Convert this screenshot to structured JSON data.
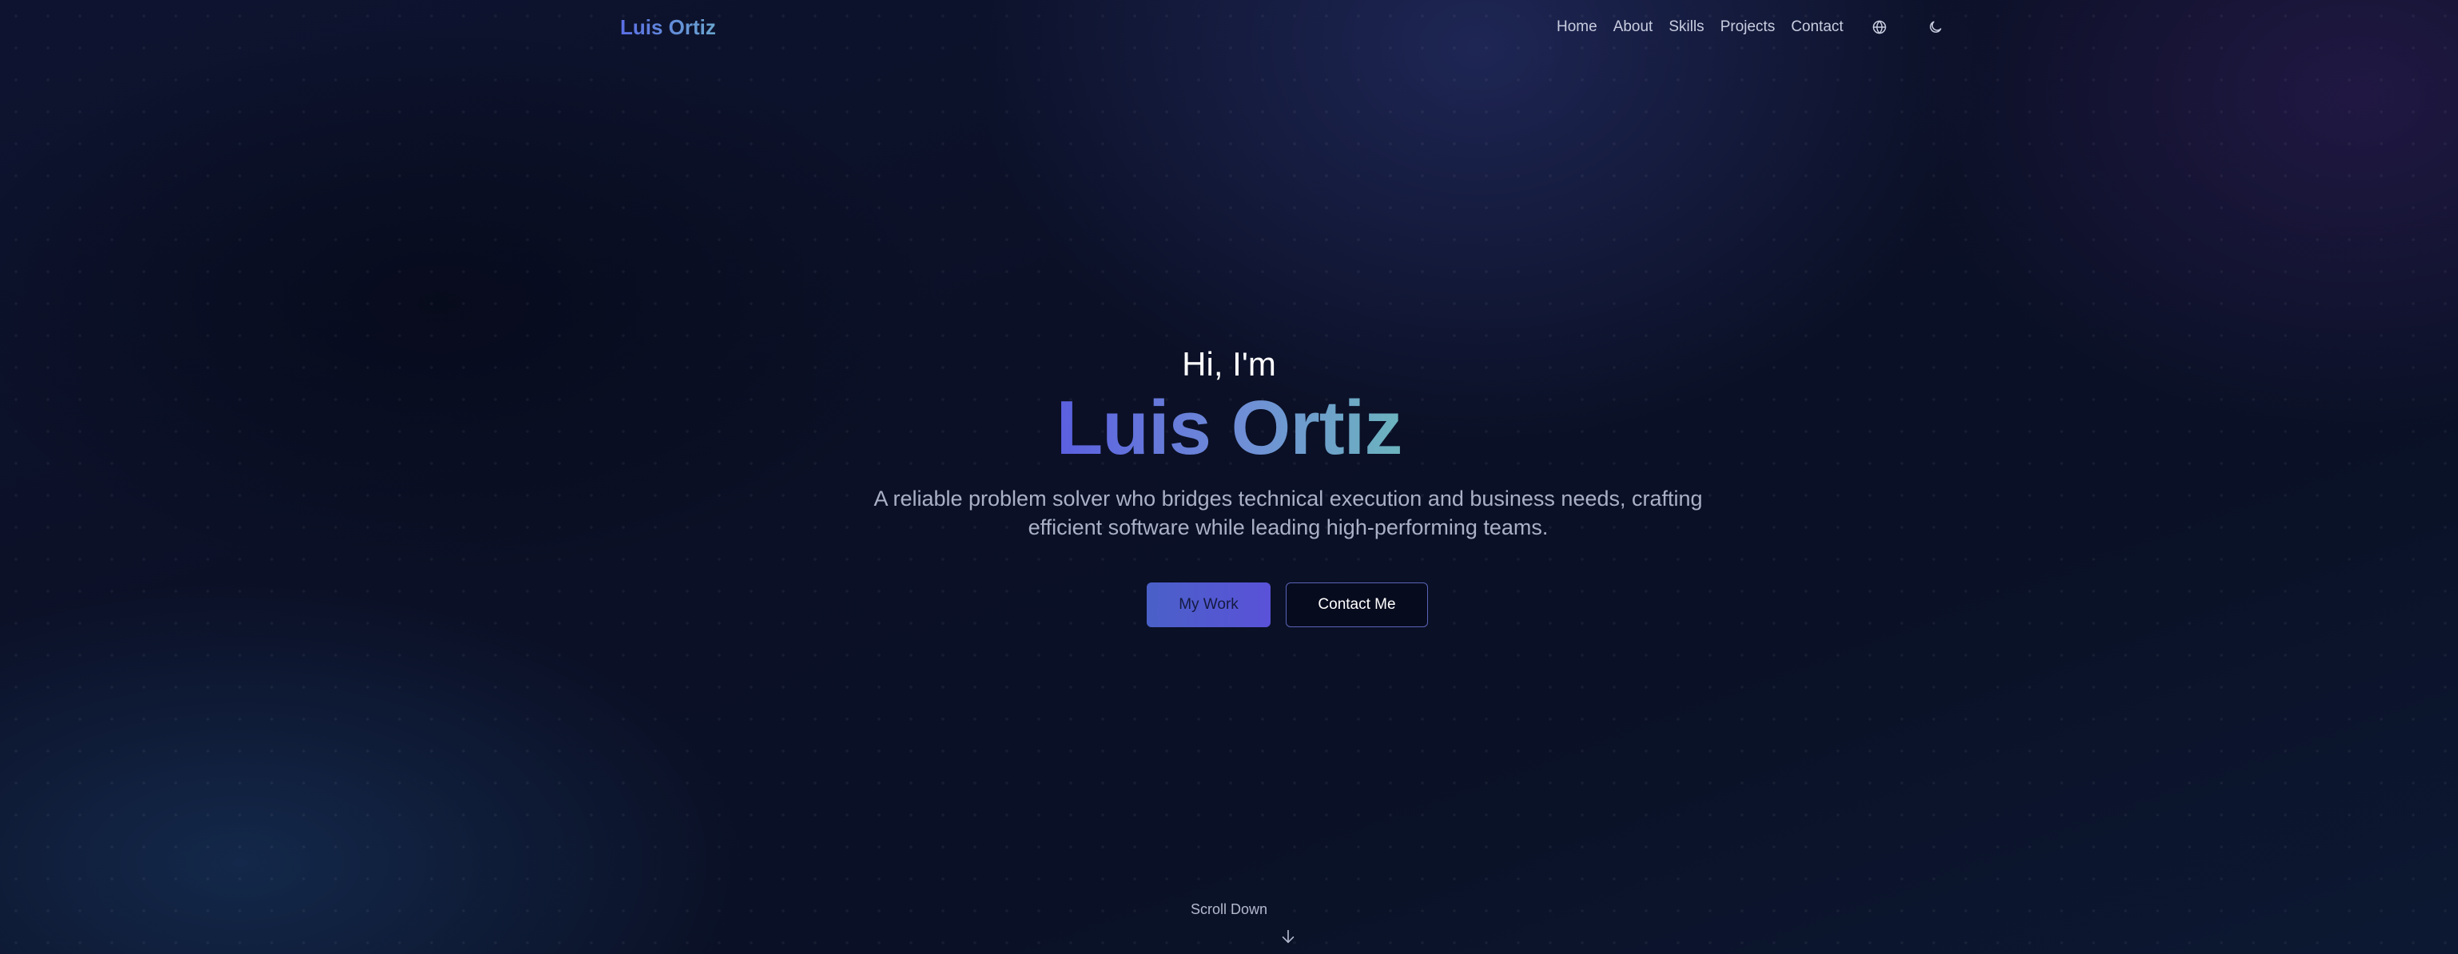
{
  "header": {
    "logo": "Luis Ortiz",
    "nav": [
      "Home",
      "About",
      "Skills",
      "Projects",
      "Contact"
    ],
    "icons": [
      "globe-icon",
      "moon-icon"
    ]
  },
  "hero": {
    "greeting": "Hi, I'm",
    "name": "Luis Ortiz",
    "tagline_line1": "A reliable problem solver who bridges technical execution and business needs, crafting",
    "tagline_line2": "efficient software while leading high-performing teams.",
    "primary_button": "My Work",
    "secondary_button": "Contact Me"
  },
  "scroll": {
    "label": "Scroll Down",
    "icon": "arrow-down-icon"
  },
  "colors": {
    "background": "#0a0f24",
    "accent_start": "#5b5fe0",
    "accent_end": "#6cb4be",
    "text_muted": "#aab1c6"
  }
}
